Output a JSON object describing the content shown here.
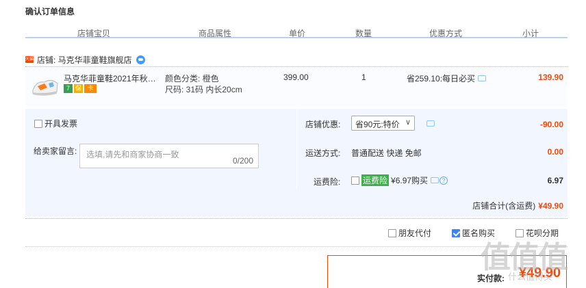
{
  "page_title": "确认订单信息",
  "columns": [
    "店铺宝贝",
    "商品属性",
    "单价",
    "数量",
    "优惠方式",
    "小计"
  ],
  "shop": {
    "icon_text": "天猫",
    "label": "店铺: 马克华菲童鞋旗舰店"
  },
  "item": {
    "title": "马克华菲童鞋2021年秋季...",
    "badges": [
      "7",
      "保",
      "卡"
    ],
    "attr_color": "颜色分类: 橙色",
    "attr_size": "尺码: 31码 内长20cm",
    "price": "399.00",
    "qty": "1",
    "promo": "省259.10:每日必买",
    "subtotal": "139.90"
  },
  "invoice_label": "开具发票",
  "memo": {
    "label": "给卖家留言:",
    "placeholder": "选填,请先和商家协商一致",
    "count": "0/200"
  },
  "discount": {
    "label": "店铺优惠:",
    "selected": "省90元:特价",
    "amount": "-90.00"
  },
  "shipping": {
    "label": "运送方式:",
    "value": "普通配送 快递 免邮",
    "amount": "0.00"
  },
  "insurance": {
    "label": "运费险:",
    "tag": "运费险",
    "value": "¥6.97购买",
    "amount": "6.97"
  },
  "shop_total": {
    "label": "店铺合计(含运费)",
    "amount": "¥49.90"
  },
  "pay_options": {
    "friend": "朋友代付",
    "anonymous": "匿名购买",
    "huabei": "花呗分期"
  },
  "final": {
    "label": "实付款:",
    "amount": "¥49.90"
  },
  "watermark": {
    "big": "值值值",
    "small": "什么值得买"
  },
  "colors": {
    "accent": "#ff4400",
    "panel": "#f2f7ff",
    "header_line": "#b2d1ff"
  }
}
